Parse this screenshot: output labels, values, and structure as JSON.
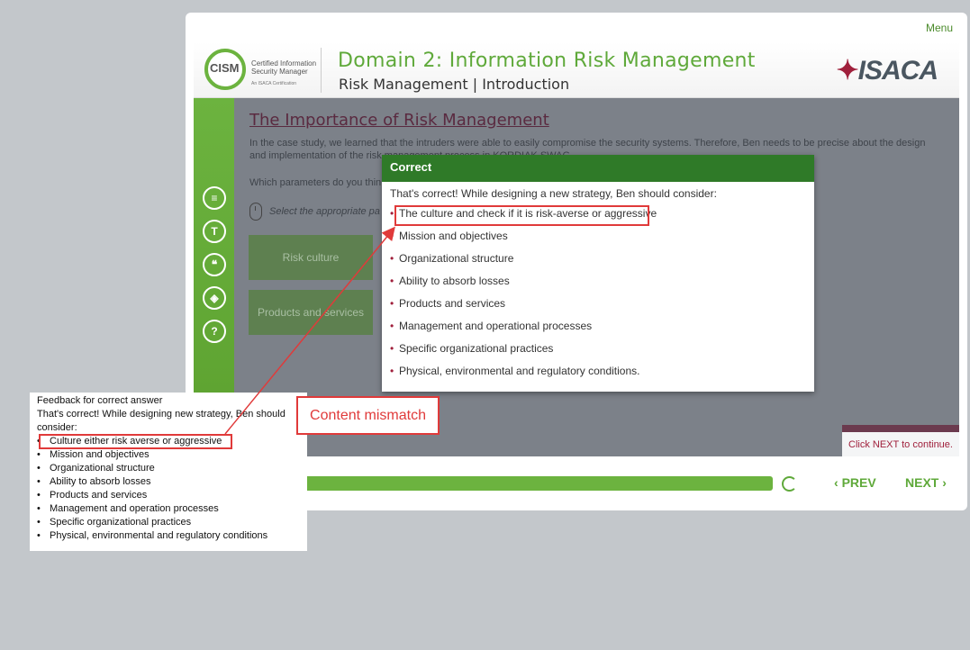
{
  "player": {
    "menu_label": "Menu",
    "logo": {
      "brand": "CISM",
      "line1": "Certified Information",
      "line2": "Security Manager",
      "tagline": "An ISACA Certification"
    },
    "domain_title": "Domain 2: Information Risk Management",
    "sub_title": "Risk Management | Introduction",
    "isaca_logo": "ISACA",
    "sidebar_icons": [
      "notes-icon",
      "transcript-icon",
      "quote-icon",
      "layers-icon",
      "help-icon"
    ]
  },
  "slide": {
    "title": "The Importance of Risk Management",
    "text": "In the case study, we learned that the intruders were able to easily compromise the security systems. Therefore, Ben needs to be precise about the design and implementation of the risk management process in KORDIAK SWAG.",
    "question": "Which parameters do you thin",
    "instruction": "Select the appropriate pa",
    "cards": [
      "Risk culture",
      "Products and services"
    ],
    "next_hint": "Click NEXT to continue."
  },
  "dialog": {
    "title": "Correct",
    "intro": "That's correct! While designing a new strategy, Ben should consider:",
    "items": [
      "The culture and check if it is risk-averse or aggressive",
      "Mission and objectives",
      "Organizational structure",
      "Ability to absorb losses",
      "Products and services",
      "Management and operational processes",
      "Specific organizational practices",
      "Physical, environmental and regulatory conditions."
    ]
  },
  "nav": {
    "prev_label": "PREV",
    "next_label": "NEXT"
  },
  "annotation": {
    "feedback_heading": "Feedback for correct answer",
    "feedback_intro": "That's correct! While designing new strategy, Ben should consider:",
    "feedback_items": [
      "Culture either risk averse or aggressive",
      "Mission and objectives",
      "Organizational structure",
      "Ability to absorb losses",
      "Products and services",
      "Management and operation processes",
      "Specific organizational practices",
      "Physical, environmental and regulatory conditions"
    ],
    "mismatch_label": "Content mismatch",
    "colors": {
      "highlight": "#e03a3a",
      "accent": "#6cb33f",
      "dialog_header": "#2f7a28"
    }
  }
}
